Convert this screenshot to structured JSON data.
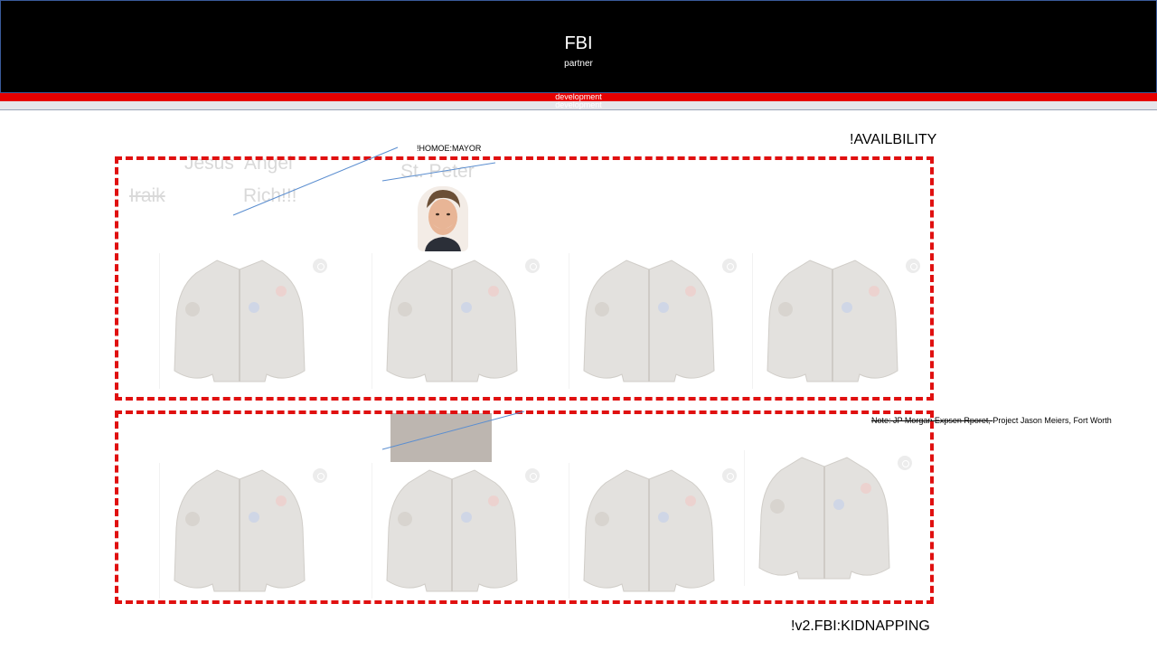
{
  "header": {
    "title": "FBI",
    "subtitle": "partner",
    "band_red_text": "development",
    "band_grey_text": "development"
  },
  "labels": {
    "availability": "!AVAILBILITY",
    "homoe_mayor": "!HOMOE:MAYOR",
    "kidnapping": "!v2.FBI:KIDNAPPING"
  },
  "note": {
    "struck": "Note: JP Morgan Expsen Rporet, ",
    "rest": "Project Jason Meiers, Fort Worth"
  },
  "ghost_names": {
    "jesus": "Jesus",
    "angel": "Angel",
    "st_peter": "St. Peter",
    "iraik": "Iraik",
    "rich": "Rich!!!"
  },
  "colors": {
    "header_bg": "#000000",
    "band_red": "#e60000",
    "band_grey": "#e5e5ea",
    "frame": "#e01010",
    "connector": "#5b8ed0"
  },
  "products": {
    "row_top": [
      "jacket-card",
      "jacket-card",
      "jacket-card",
      "jacket-card"
    ],
    "row_bottom": [
      "jacket-card",
      "jacket-card",
      "jacket-card",
      "jacket-card"
    ]
  }
}
